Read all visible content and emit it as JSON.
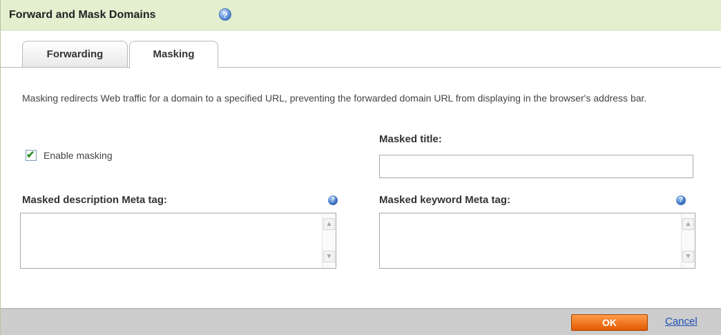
{
  "dialog": {
    "title": "Forward and Mask Domains",
    "help_icon": "help-icon"
  },
  "tabs": [
    {
      "label": "Forwarding",
      "active": false
    },
    {
      "label": "Masking",
      "active": true
    }
  ],
  "masking": {
    "description": "Masking redirects Web traffic for a domain to a specified URL, preventing the forwarded domain URL from displaying in the browser's address bar.",
    "enable_label": "Enable masking",
    "enable_checked": true,
    "title_label": "Masked title:",
    "title_value": "",
    "description_meta_label": "Masked description Meta tag:",
    "description_meta_value": "",
    "keyword_meta_label": "Masked keyword Meta tag:",
    "keyword_meta_value": ""
  },
  "footer": {
    "ok_label": "OK",
    "cancel_label": "Cancel"
  },
  "colors": {
    "header_bg": "#e3efcf",
    "ok_button": "#f07a1e",
    "link": "#1f4fb5",
    "check": "#2e8b2e"
  }
}
